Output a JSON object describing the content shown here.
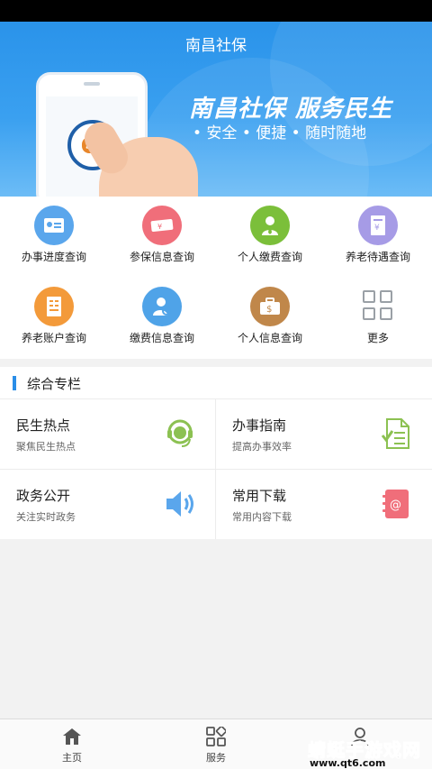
{
  "app": {
    "title": "南昌社保"
  },
  "banner": {
    "slogan": "南昌社保  服务民生",
    "features": "• 安全  • 便捷  • 随时随地",
    "logo_text": "SI"
  },
  "services": [
    {
      "label": "办事进度查询",
      "icon": "id-card-icon",
      "color": "#5aa6ec"
    },
    {
      "label": "参保信息查询",
      "icon": "ticket-icon",
      "color": "#f06e7a"
    },
    {
      "label": "个人缴费查询",
      "icon": "person-tie-icon",
      "color": "#7bbf3a"
    },
    {
      "label": "养老待遇查询",
      "icon": "document-yen-icon",
      "color": "#a69be6"
    },
    {
      "label": "养老账户查询",
      "icon": "ledger-icon",
      "color": "#f39a3a"
    },
    {
      "label": "缴费信息查询",
      "icon": "person-search-icon",
      "color": "#4fa3e8"
    },
    {
      "label": "个人信息查询",
      "icon": "briefcase-dollar-icon",
      "color": "#c0874a"
    },
    {
      "label": "更多",
      "icon": "grid-more-icon",
      "color": "#9aa0a6"
    }
  ],
  "section": {
    "title": "综合专栏",
    "cards": [
      {
        "title": "民生热点",
        "subtitle": "聚焦民生热点",
        "icon": "headset-icon",
        "color": "#8cc152"
      },
      {
        "title": "办事指南",
        "subtitle": "提高办事效率",
        "icon": "checklist-icon",
        "color": "#8cc152"
      },
      {
        "title": "政务公开",
        "subtitle": "关注实时政务",
        "icon": "speaker-icon",
        "color": "#5aa6ec"
      },
      {
        "title": "常用下载",
        "subtitle": "常用内容下载",
        "icon": "address-book-icon",
        "color": "#f06e7a"
      }
    ]
  },
  "tabbar": {
    "items": [
      {
        "label": "主页",
        "icon": "home-icon"
      },
      {
        "label": "服务",
        "icon": "services-grid-icon"
      },
      {
        "label": "",
        "icon": "user-icon"
      }
    ]
  },
  "watermark": {
    "text": "蜻蜓手游戏网",
    "url": "www.qt6.com"
  }
}
